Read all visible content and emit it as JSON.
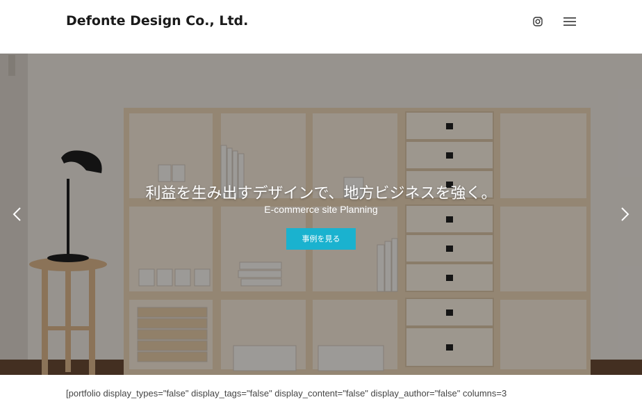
{
  "header": {
    "brand": "Defonte Design Co., Ltd.",
    "instagram_icon": "instagram-icon",
    "menu_icon": "hamburger-menu-icon"
  },
  "hero": {
    "headline": "利益を生み出すデザインで、地方ビジネスを強く。",
    "subheading": "E-commerce site Planning",
    "cta_label": "事例を見る",
    "accent_color": "#1ab2cf",
    "prev_icon": "chevron-left-icon",
    "next_icon": "chevron-right-icon"
  },
  "content": {
    "shortcode_text": "[portfolio display_types=\"false\" display_tags=\"false\" display_content=\"false\" display_author=\"false\" columns=3"
  }
}
